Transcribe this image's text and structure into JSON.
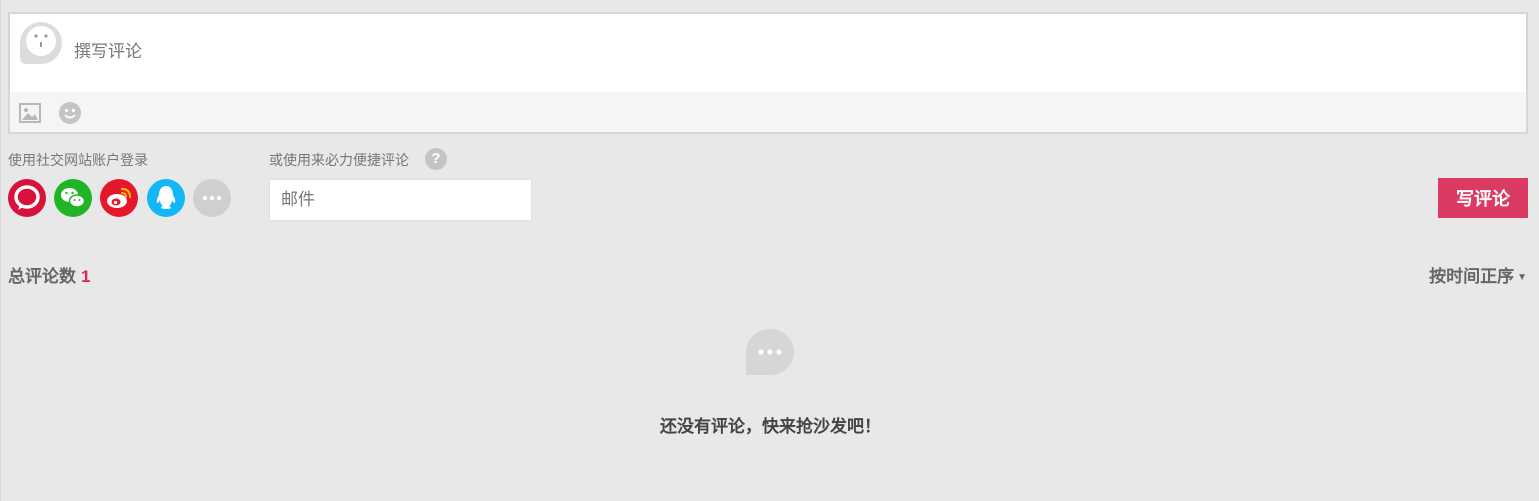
{
  "comment_box": {
    "placeholder": "撰写评论",
    "tools": {
      "image_icon": "image-icon",
      "emoji_icon": "emoji-icon"
    }
  },
  "social_login": {
    "label": "使用社交网站账户登录",
    "providers": [
      {
        "name": "laibili",
        "color": "#d8123a"
      },
      {
        "name": "wechat",
        "color": "#20b527"
      },
      {
        "name": "weibo",
        "color": "#e6162d"
      },
      {
        "name": "qq",
        "color": "#12b7f5"
      },
      {
        "name": "more",
        "color": "#cfcfcf"
      }
    ]
  },
  "quick_comment": {
    "label": "或使用来必力便捷评论",
    "help": "?",
    "email_placeholder": "邮件"
  },
  "submit": {
    "label": "写评论",
    "color": "#db3a63"
  },
  "stats": {
    "total_label": "总评论数",
    "total_count": "1",
    "sort_label": "按时间正序",
    "sort_caret": "▼"
  },
  "empty_state": {
    "icon": "speech-bubble-icon",
    "message": "还没有评论，快来抢沙发吧！"
  }
}
